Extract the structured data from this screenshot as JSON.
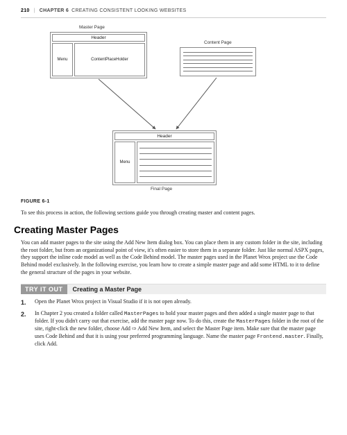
{
  "header": {
    "page_number": "210",
    "chapter_label": "CHAPTER 6",
    "chapter_title": "CREATING CONSISTENT LOOKING WEBSITES"
  },
  "figure": {
    "master_page_label": "Master Page",
    "content_page_label": "Content Page",
    "final_page_label": "Final Page",
    "header_text": "Header",
    "menu_text": "Menu",
    "cph_text": "ContentPlaceHolder",
    "caption": "FIGURE 6-1"
  },
  "para_intro": "To see this process in action, the following sections guide you through creating master and content pages.",
  "section_heading": "Creating Master Pages",
  "section_para_1": "You can add master pages to the site using the Add New Item dialog box. You can place them in any custom folder in the site, including the root folder, but from an organizational point of view, it's often easier to store them in a separate folder. Just like normal ASPX pages, they support the inline code model as well as the Code Behind model. The master pages used in the Planet Wrox project use the Code Behind model exclusively. In the following exercise, you learn how to create a simple master page and add some HTML to it to define the general structure of the pages in your website.",
  "tryitout": {
    "label": "TRY IT OUT",
    "title": "Creating a Master Page"
  },
  "steps": {
    "s1": "Open the Planet Wrox project in Visual Studio if it is not open already.",
    "s2_a": "In Chapter 2 you created a folder called ",
    "s2_code1": "MasterPages",
    "s2_b": " to hold your master pages and then added a single master page to that folder. If you didn't carry out that exercise, add the master page now. To do this, create the ",
    "s2_code2": "MasterPages",
    "s2_c": " folder in the root of the site, right-click the new folder, choose Add ⇨ Add New Item, and select the Master Page item. Make sure that the master page uses Code Behind and that it is using your preferred programming language. Name the master page ",
    "s2_code3": "Frontend.master",
    "s2_d": ". Finally, click Add."
  }
}
